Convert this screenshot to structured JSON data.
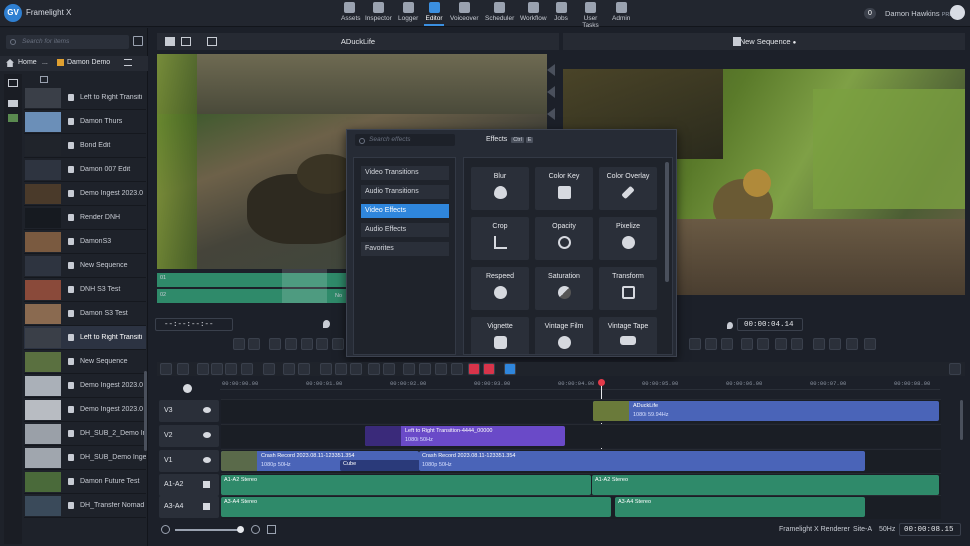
{
  "app": {
    "name": "Framelight X",
    "logo": "GV"
  },
  "nav": [
    {
      "label": "Assets",
      "icon": "assets-icon"
    },
    {
      "label": "Inspector",
      "icon": "inspector-icon"
    },
    {
      "label": "Logger",
      "icon": "logger-icon"
    },
    {
      "label": "Editor",
      "icon": "editor-icon",
      "active": true
    },
    {
      "label": "Voiceover",
      "icon": "microphone-icon"
    },
    {
      "label": "Scheduler",
      "icon": "scheduler-icon"
    },
    {
      "label": "Workflow",
      "icon": "workflow-icon"
    },
    {
      "label": "Jobs",
      "icon": "jobs-icon"
    },
    {
      "label": "User Tasks",
      "icon": "user-tasks-icon"
    },
    {
      "label": "Admin",
      "icon": "admin-icon"
    }
  ],
  "user": {
    "badge": "0",
    "name": "Damon Hawkins",
    "tag": "PRE"
  },
  "browser": {
    "search_placeholder": "Search for items",
    "crumb_home": "Home",
    "crumb_sep": "...",
    "crumb_current": "Damon Demo",
    "items": [
      {
        "label": "Left to Right Transiti",
        "thumb": "#3a3f48"
      },
      {
        "label": "Damon Thurs",
        "thumb": "#6b8fb8"
      },
      {
        "label": "Bond Edit",
        "thumb": "#20242b"
      },
      {
        "label": "Damon 007 Edit",
        "thumb": "#2e3440"
      },
      {
        "label": "Demo Ingest 2023.0",
        "thumb": "#4a3a2a"
      },
      {
        "label": "Render DNH",
        "thumb": "#161a20"
      },
      {
        "label": "DamonS3",
        "thumb": "#7a5a40"
      },
      {
        "label": "New Sequence",
        "thumb": "#2e3440"
      },
      {
        "label": "DNH S3 Test",
        "thumb": "#8a4a3a"
      },
      {
        "label": "Damon S3 Test",
        "thumb": "#8a6a50"
      },
      {
        "label": "Left to Right Transiti",
        "thumb": "#3a3f48",
        "selected": true
      },
      {
        "label": "New Sequence",
        "thumb": "#5a7040"
      },
      {
        "label": "Demo Ingest 2023.0",
        "thumb": "#aab0b8"
      },
      {
        "label": "Demo Ingest 2023.0",
        "thumb": "#b8bcc2"
      },
      {
        "label": "DH_SUB_2_Demo Ing",
        "thumb": "#9aa0a8"
      },
      {
        "label": "DH_SUB_Demo Inge",
        "thumb": "#a0a6ae"
      },
      {
        "label": "Damon Future Test",
        "thumb": "#4a6a3a"
      },
      {
        "label": "DH_Transfer Nomad",
        "thumb": "#3a4a5a"
      }
    ]
  },
  "source": {
    "title": "ADuckLife",
    "timecode": "--:--:--:--",
    "track1": "01",
    "track2": "02",
    "no_label": "No"
  },
  "program": {
    "title": "New Sequence",
    "timecode": "00:00:04.14"
  },
  "effects": {
    "search_placeholder": "Search effects",
    "title": "Effects",
    "shortcut1": "Ctrl",
    "shortcut2": "E",
    "categories": [
      "Video Transitions",
      "Audio Transitions",
      "Video Effects",
      "Audio Effects",
      "Favorites"
    ],
    "selected_category": "Video Effects",
    "tiles": [
      {
        "label": "Blur",
        "icon": "blur-drop-icon"
      },
      {
        "label": "Color Key",
        "icon": "color-key-icon"
      },
      {
        "label": "Color Overlay",
        "icon": "paint-brush-icon"
      },
      {
        "label": "Crop",
        "icon": "crop-icon"
      },
      {
        "label": "Opacity",
        "icon": "opacity-icon"
      },
      {
        "label": "Pixelize",
        "icon": "pixelize-icon"
      },
      {
        "label": "Respeed",
        "icon": "respeed-icon"
      },
      {
        "label": "Saturation",
        "icon": "saturation-icon"
      },
      {
        "label": "Transform",
        "icon": "transform-icon"
      },
      {
        "label": "Vignette",
        "icon": "vignette-icon"
      },
      {
        "label": "Vintage Film",
        "icon": "film-reel-icon"
      },
      {
        "label": "Vintage Tape",
        "icon": "tape-icon"
      }
    ]
  },
  "timeline": {
    "ticks": [
      "00:00:00.00",
      "00:00:01.00",
      "00:00:02.00",
      "00:00:03.00",
      "00:00:04.00",
      "00:00:05.00",
      "00:00:06.00",
      "00:00:07.00",
      "00:00:08.00"
    ],
    "tracks": [
      "V3",
      "V2",
      "V1",
      "A1-A2",
      "A3-A4"
    ],
    "clips": {
      "v3_name": "ADuckLife",
      "v3_fmt": "1080i 59.94Hz",
      "v2_name": "Left to Right Transition-4444_00000",
      "v2_fmt": "1080i 50Hz",
      "v1a_name": "Crash Record 2023.08.11-123351.354",
      "v1a_fmt": "1080p 50Hz",
      "v1_cube": "Cube",
      "v1b_name": "Crash Record 2023.08.11-123351.354",
      "v1b_fmt": "1080p 50Hz",
      "a12a": "A1-A2 Stereo",
      "a12b": "A1-A2 Stereo",
      "a34a": "A3-A4 Stereo",
      "a34b": "A3-A4 Stereo"
    }
  },
  "status": {
    "renderer": "Framelight X Renderer",
    "site": "Site-A",
    "rate": "50Hz",
    "duration": "00:00:08.15"
  }
}
